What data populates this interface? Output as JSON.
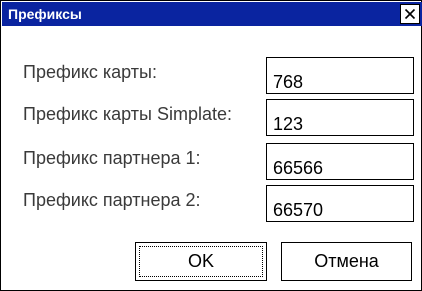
{
  "window": {
    "title": "Префиксы",
    "title_bar_color": "#0a24a0",
    "close_icon": "close-icon"
  },
  "fields": [
    {
      "label": "Префикс карты:",
      "value": "768"
    },
    {
      "label": "Префикс карты Simplate:",
      "value": "123"
    },
    {
      "label": "Префикс партнера 1:",
      "value": "66566"
    },
    {
      "label": "Префикс партнера 2:",
      "value": "66570"
    }
  ],
  "buttons": {
    "ok_label": "OK",
    "cancel_label": "Отмена"
  }
}
